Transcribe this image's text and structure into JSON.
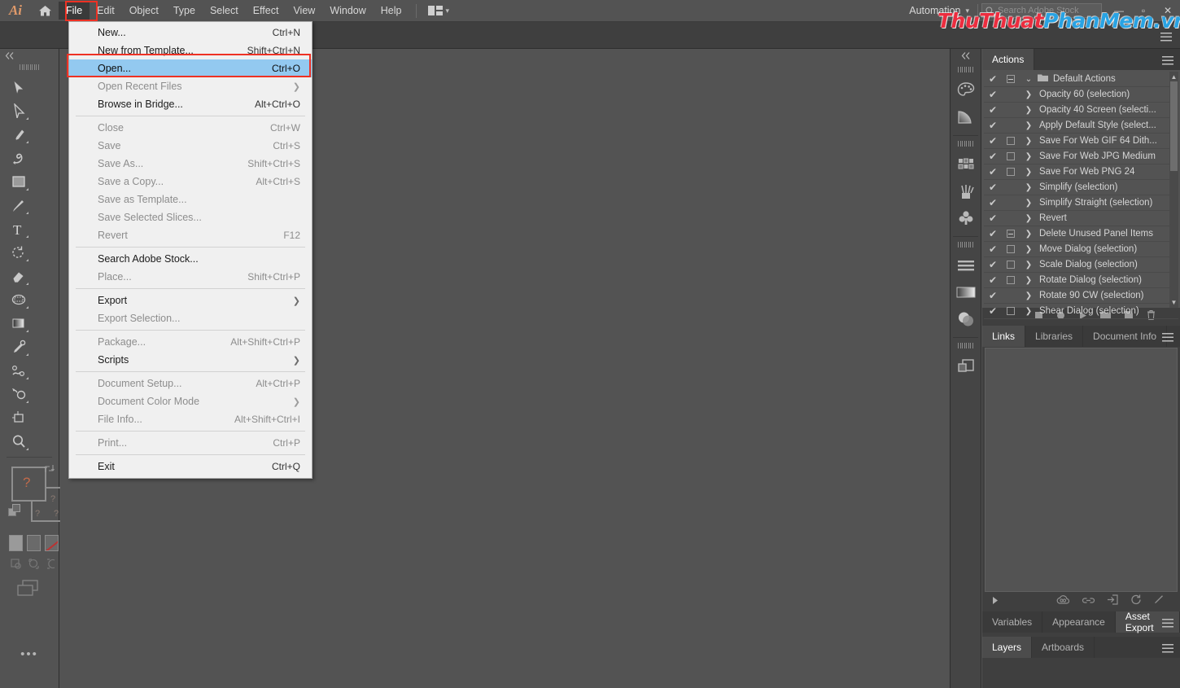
{
  "app": {
    "logo": "Ai",
    "home_icon": "home-icon"
  },
  "menubar": {
    "items": [
      {
        "label": "File",
        "active": true
      },
      {
        "label": "Edit",
        "active": false
      },
      {
        "label": "Object",
        "active": false
      },
      {
        "label": "Type",
        "active": false
      },
      {
        "label": "Select",
        "active": false
      },
      {
        "label": "Effect",
        "active": false
      },
      {
        "label": "View",
        "active": false
      },
      {
        "label": "Window",
        "active": false
      },
      {
        "label": "Help",
        "active": false
      }
    ],
    "arrange_icon": "arrange-documents-icon",
    "arrange_caret": "▾",
    "automation_label": "Automation",
    "automation_caret": "▾",
    "search_placeholder": "Search Adobe Stock",
    "search_icon": "search-icon",
    "window_minimize": "—",
    "window_maximize": "▫",
    "window_close": "✕"
  },
  "watermark": {
    "part1": "ThuThuat",
    "part2": "PhanMem.vn",
    "color1": "#ec2d3f",
    "color2": "#29a3e3"
  },
  "highlight": {
    "color": "#ee3124",
    "file_menu_target": "File",
    "open_item_target": "Open..."
  },
  "file_menu": {
    "title": "File",
    "groups": [
      {
        "items": [
          {
            "label": "New...",
            "shortcut": "Ctrl+N",
            "state": "enabled",
            "submenu": false
          },
          {
            "label": "New from Template...",
            "shortcut": "Shift+Ctrl+N",
            "state": "enabled",
            "submenu": false
          },
          {
            "label": "Open...",
            "shortcut": "Ctrl+O",
            "state": "highlighted",
            "submenu": false
          },
          {
            "label": "Open Recent Files",
            "shortcut": "",
            "state": "disabled",
            "submenu": true
          },
          {
            "label": "Browse in Bridge...",
            "shortcut": "Alt+Ctrl+O",
            "state": "enabled",
            "submenu": false
          }
        ]
      },
      {
        "items": [
          {
            "label": "Close",
            "shortcut": "Ctrl+W",
            "state": "disabled",
            "submenu": false
          },
          {
            "label": "Save",
            "shortcut": "Ctrl+S",
            "state": "disabled",
            "submenu": false
          },
          {
            "label": "Save As...",
            "shortcut": "Shift+Ctrl+S",
            "state": "disabled",
            "submenu": false
          },
          {
            "label": "Save a Copy...",
            "shortcut": "Alt+Ctrl+S",
            "state": "disabled",
            "submenu": false
          },
          {
            "label": "Save as Template...",
            "shortcut": "",
            "state": "disabled",
            "submenu": false
          },
          {
            "label": "Save Selected Slices...",
            "shortcut": "",
            "state": "disabled",
            "submenu": false
          },
          {
            "label": "Revert",
            "shortcut": "F12",
            "state": "disabled",
            "submenu": false
          }
        ]
      },
      {
        "items": [
          {
            "label": "Search Adobe Stock...",
            "shortcut": "",
            "state": "enabled",
            "submenu": false
          },
          {
            "label": "Place...",
            "shortcut": "Shift+Ctrl+P",
            "state": "disabled",
            "submenu": false
          }
        ]
      },
      {
        "items": [
          {
            "label": "Export",
            "shortcut": "",
            "state": "enabled",
            "submenu": true
          },
          {
            "label": "Export Selection...",
            "shortcut": "",
            "state": "disabled",
            "submenu": false
          }
        ]
      },
      {
        "items": [
          {
            "label": "Package...",
            "shortcut": "Alt+Shift+Ctrl+P",
            "state": "disabled",
            "submenu": false
          },
          {
            "label": "Scripts",
            "shortcut": "",
            "state": "enabled",
            "submenu": true
          }
        ]
      },
      {
        "items": [
          {
            "label": "Document Setup...",
            "shortcut": "Alt+Ctrl+P",
            "state": "disabled",
            "submenu": false
          },
          {
            "label": "Document Color Mode",
            "shortcut": "",
            "state": "disabled",
            "submenu": true
          },
          {
            "label": "File Info...",
            "shortcut": "Alt+Shift+Ctrl+I",
            "state": "disabled",
            "submenu": false
          }
        ]
      },
      {
        "items": [
          {
            "label": "Print...",
            "shortcut": "Ctrl+P",
            "state": "disabled",
            "submenu": false
          }
        ]
      },
      {
        "items": [
          {
            "label": "Exit",
            "shortcut": "Ctrl+Q",
            "state": "enabled",
            "submenu": false
          }
        ]
      }
    ]
  },
  "toolbar": {
    "collapse_icon": "double-chevron-left-icon",
    "tools": [
      {
        "name": "selection-tool",
        "has_corner": false
      },
      {
        "name": "direct-selection-tool",
        "has_corner": true
      },
      {
        "name": "pen-tool",
        "has_corner": true
      },
      {
        "name": "curvature-tool",
        "has_corner": false
      },
      {
        "name": "rectangle-tool",
        "has_corner": true
      },
      {
        "name": "paintbrush-tool",
        "has_corner": true
      },
      {
        "name": "type-tool",
        "has_corner": true
      },
      {
        "name": "rotate-tool",
        "has_corner": true
      },
      {
        "name": "eraser-tool",
        "has_corner": true
      },
      {
        "name": "free-transform-tool",
        "has_corner": true
      },
      {
        "name": "gradient-tool",
        "has_corner": true
      },
      {
        "name": "eyedropper-tool",
        "has_corner": true
      },
      {
        "name": "blend-tool",
        "has_corner": true
      },
      {
        "name": "shape-builder-tool",
        "has_corner": true
      },
      {
        "name": "artboard-tool",
        "has_corner": false
      },
      {
        "name": "zoom-tool",
        "has_corner": true
      }
    ],
    "fill_stroke": {
      "fill_name": "fill-swatch",
      "stroke_name": "stroke-swatch",
      "swap_icon": "swap-fill-stroke-icon",
      "default_icon": "default-fill-stroke-icon",
      "q1": "?",
      "q2": "?",
      "q3": "?",
      "q4": "?"
    },
    "color_modes": [
      {
        "name": "color-mode-color"
      },
      {
        "name": "color-mode-gradient"
      },
      {
        "name": "color-mode-none"
      }
    ],
    "draw_modes": [
      {
        "name": "draw-normal-mode"
      },
      {
        "name": "draw-behind-mode"
      },
      {
        "name": "draw-inside-mode"
      }
    ],
    "screen_mode": "change-screen-mode-icon",
    "more_tools": "•••"
  },
  "dock": {
    "collapse_icon": "double-chevron-left-icon",
    "groups": [
      {
        "icons": [
          {
            "name": "color-panel-icon"
          },
          {
            "name": "gradient-panel-icon"
          }
        ]
      },
      {
        "icons": [
          {
            "name": "swatches-panel-icon"
          },
          {
            "name": "brushes-panel-icon"
          },
          {
            "name": "symbols-panel-icon"
          }
        ]
      },
      {
        "icons": [
          {
            "name": "align-panel-icon"
          },
          {
            "name": "gradient-bar-panel-icon"
          },
          {
            "name": "transparency-panel-icon"
          }
        ]
      },
      {
        "icons": [
          {
            "name": "layers-panel-icon"
          }
        ]
      }
    ]
  },
  "actions_panel": {
    "tabs": [
      {
        "label": "Actions",
        "selected": true
      }
    ],
    "menu_icon": "panel-menu-icon",
    "set": {
      "label": "Default Actions",
      "checked": true,
      "box": "dash",
      "expanded": true,
      "folder_icon": "folder-icon",
      "chevron": "chevron-down-icon"
    },
    "rows": [
      {
        "label": "Opacity 60 (selection)",
        "checked": true,
        "box": "none"
      },
      {
        "label": "Opacity 40 Screen (selecti...",
        "checked": true,
        "box": "none"
      },
      {
        "label": "Apply Default Style (select...",
        "checked": true,
        "box": "none"
      },
      {
        "label": "Save For Web GIF 64 Dith...",
        "checked": true,
        "box": "empty"
      },
      {
        "label": "Save For Web JPG Medium",
        "checked": true,
        "box": "empty"
      },
      {
        "label": "Save For Web PNG 24",
        "checked": true,
        "box": "empty"
      },
      {
        "label": "Simplify (selection)",
        "checked": true,
        "box": "none"
      },
      {
        "label": "Simplify Straight (selection)",
        "checked": true,
        "box": "none"
      },
      {
        "label": "Revert",
        "checked": true,
        "box": "none"
      },
      {
        "label": "Delete Unused Panel Items",
        "checked": true,
        "box": "dash"
      },
      {
        "label": "Move Dialog (selection)",
        "checked": true,
        "box": "empty"
      },
      {
        "label": "Scale Dialog (selection)",
        "checked": true,
        "box": "empty"
      },
      {
        "label": "Rotate Dialog (selection)",
        "checked": true,
        "box": "empty"
      },
      {
        "label": "Rotate 90 CW (selection)",
        "checked": true,
        "box": "none"
      },
      {
        "label": "Shear Dialog (selection)",
        "checked": true,
        "box": "empty"
      }
    ],
    "scroll_up": "▲",
    "scroll_down": "▼",
    "footer_icons": [
      {
        "name": "stop-playing-button"
      },
      {
        "name": "begin-recording-button"
      },
      {
        "name": "play-current-selection-button"
      },
      {
        "name": "create-new-set-button"
      },
      {
        "name": "create-new-action-button"
      },
      {
        "name": "delete-selection-button"
      }
    ]
  },
  "links_panel": {
    "tabs": [
      {
        "label": "Links",
        "selected": true
      },
      {
        "label": "Libraries",
        "selected": false
      },
      {
        "label": "Document Info",
        "selected": false
      }
    ],
    "menu_icon": "panel-menu-icon",
    "footer_icons": [
      {
        "name": "expand-triangle-icon"
      },
      {
        "name": "cloud-link-icon"
      },
      {
        "name": "relink-from-cc-libraries-icon"
      },
      {
        "name": "go-to-link-icon"
      },
      {
        "name": "update-link-icon"
      },
      {
        "name": "edit-original-icon"
      }
    ]
  },
  "bottom_panels": {
    "row1": {
      "tabs": [
        {
          "label": "Variables",
          "selected": false
        },
        {
          "label": "Appearance",
          "selected": false
        },
        {
          "label": "Asset Export",
          "selected": true
        }
      ],
      "menu_icon": "panel-menu-icon"
    },
    "row2": {
      "tabs": [
        {
          "label": "Layers",
          "selected": true
        },
        {
          "label": "Artboards",
          "selected": false
        }
      ],
      "menu_icon": "panel-menu-icon"
    }
  }
}
